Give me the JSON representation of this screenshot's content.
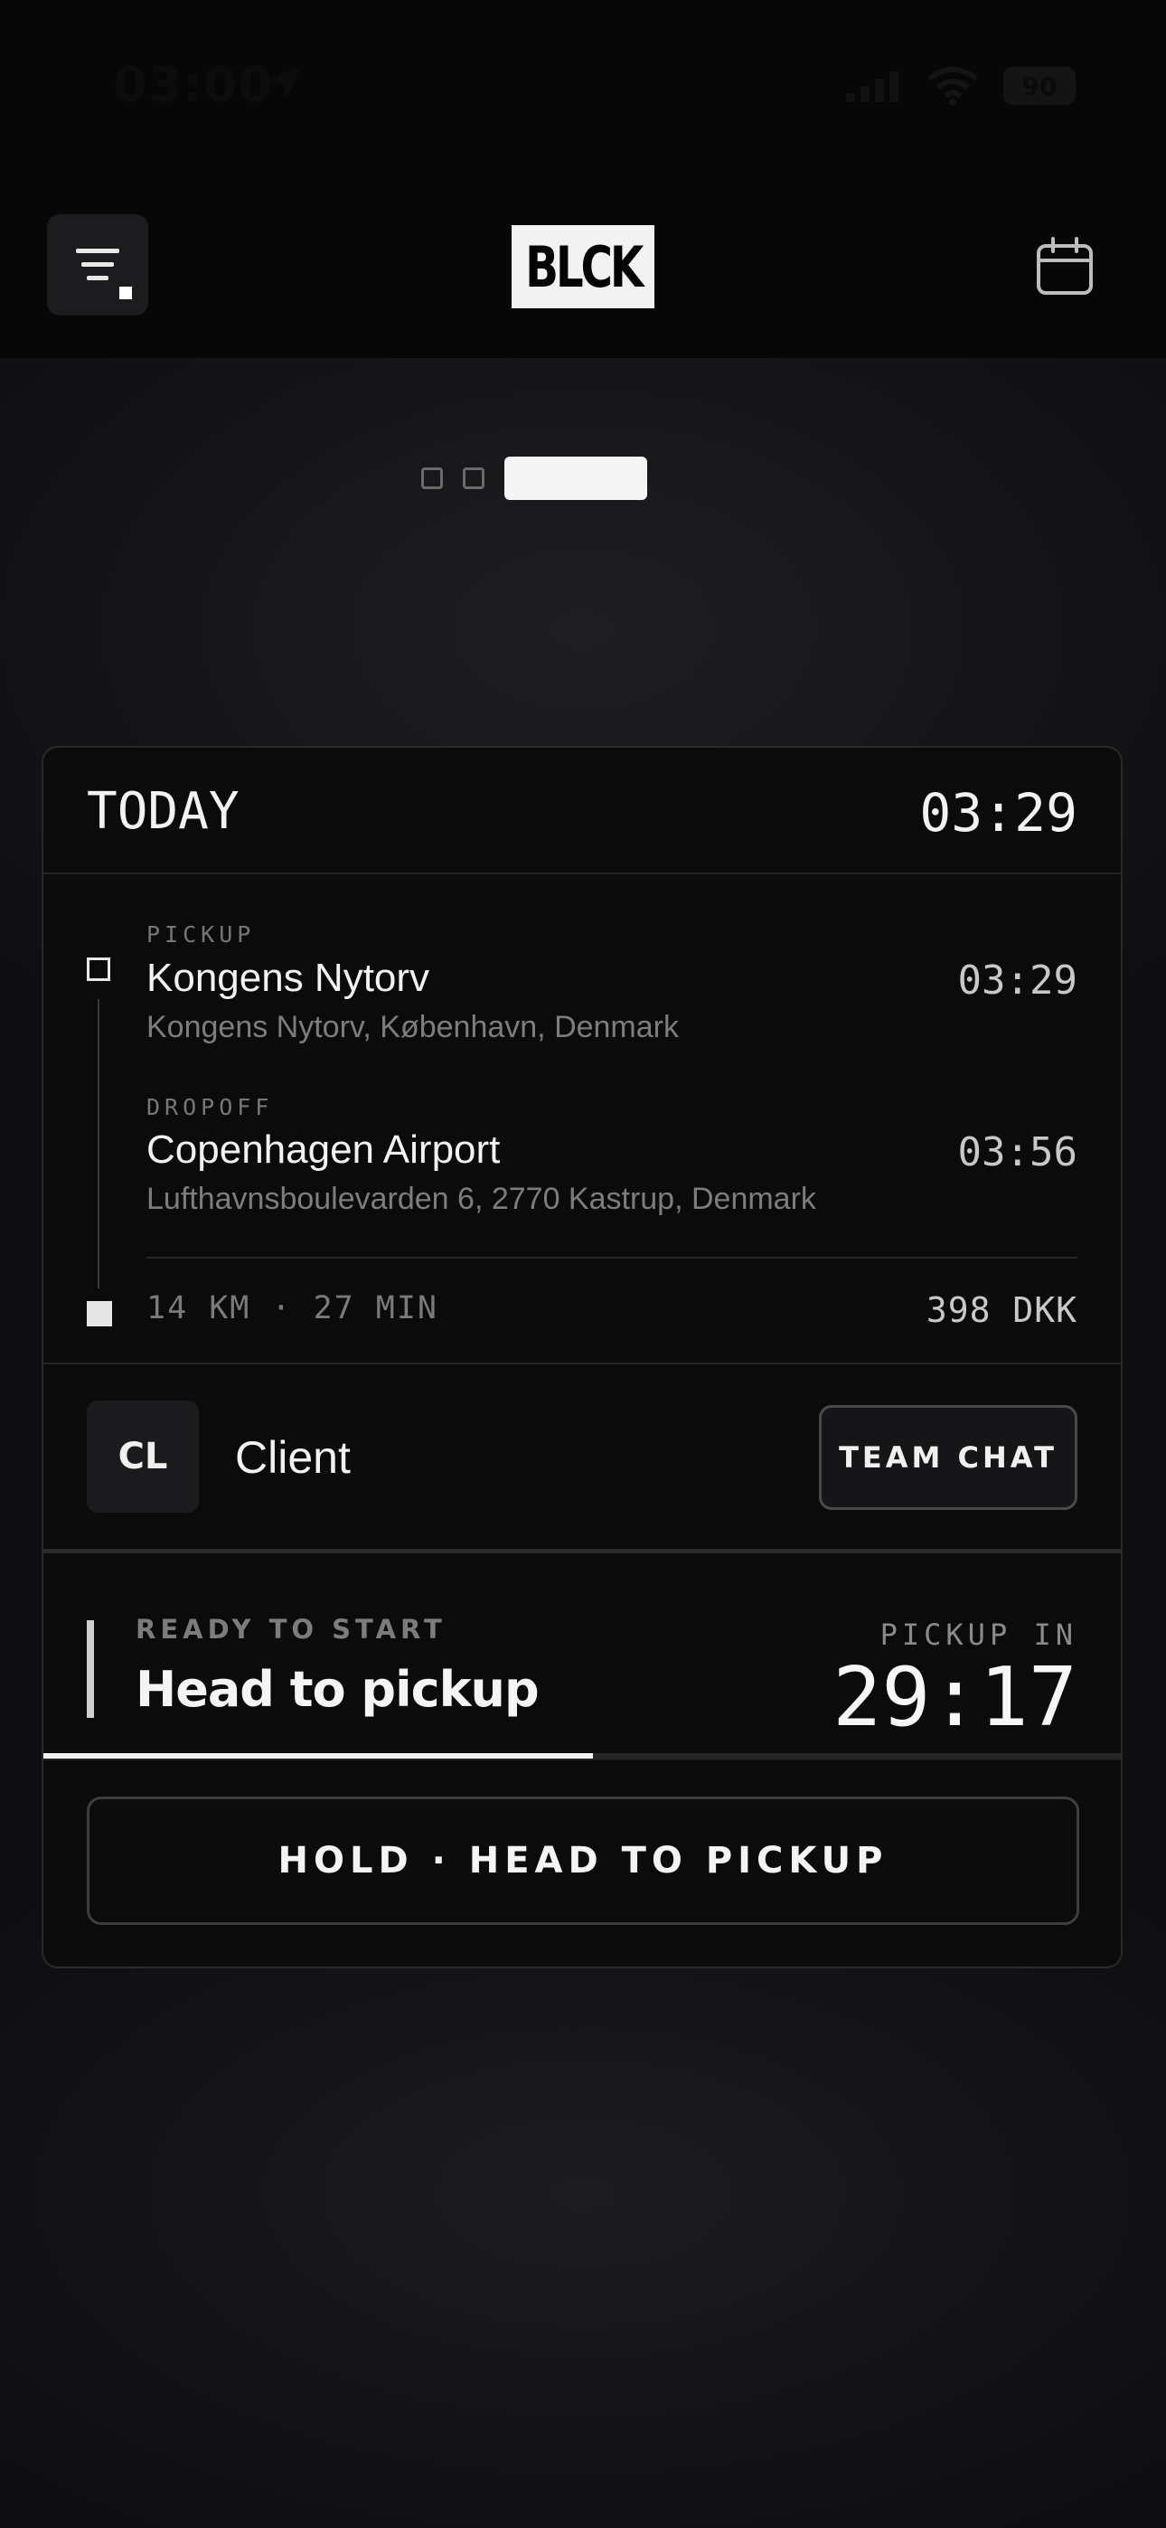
{
  "status_bar": {
    "time": "03:00",
    "battery": "90"
  },
  "app_bar": {
    "logo": "BLCK"
  },
  "pager": {
    "active_index": 2,
    "count": 3
  },
  "trip": {
    "header": {
      "day": "TODAY",
      "time": "03:29"
    },
    "pickup": {
      "label": "PICKUP",
      "place": "Kongens Nytorv",
      "address": "Kongens Nytorv, København, Denmark",
      "time": "03:29"
    },
    "dropoff": {
      "label": "DROPOFF",
      "place": "Copenhagen Airport",
      "address": "Lufthavnsboulevarden 6, 2770 Kastrup, Denmark",
      "time": "03:56"
    },
    "summary": {
      "distance_duration": "14 KM · 27 MIN",
      "price": "398 DKK"
    },
    "client": {
      "initials": "CL",
      "name": "Client",
      "chat_label": "TEAM CHAT"
    },
    "status": {
      "label": "READY TO START",
      "title": "Head to pickup",
      "countdown_label": "PICKUP IN",
      "countdown": "29:17",
      "progress_fraction": 0.51
    },
    "action": {
      "label": "HOLD · HEAD TO PICKUP"
    }
  },
  "colors": {
    "background": "#0e0e10",
    "card": "#0b0b0c",
    "accent": "#f2f2f2"
  }
}
